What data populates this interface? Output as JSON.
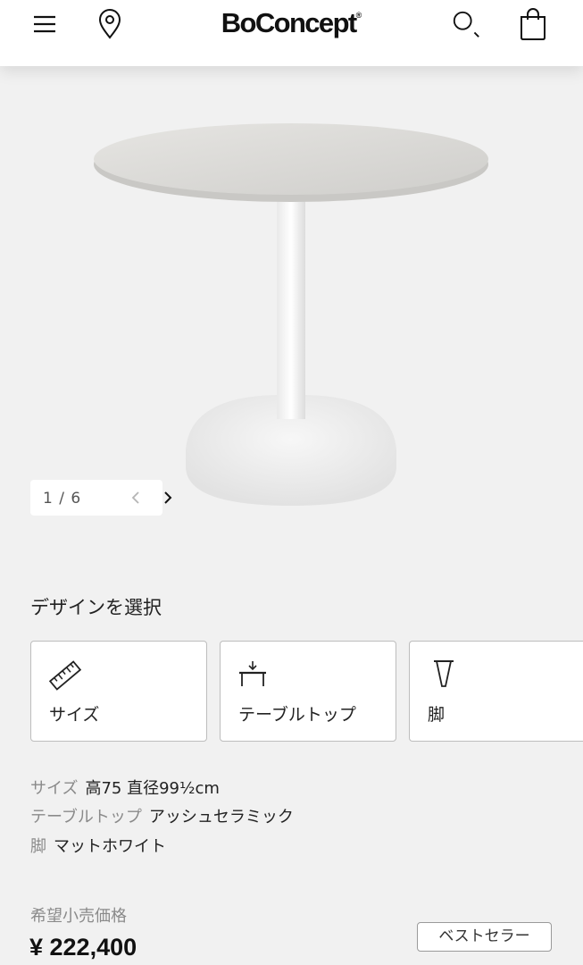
{
  "header": {
    "logo_text": "BoConcept",
    "logo_mark": "®",
    "icons": [
      "menu-icon",
      "location-pin-icon",
      "search-icon",
      "shopping-bag-icon"
    ]
  },
  "gallery": {
    "counter": "1 / 6",
    "current": 1,
    "total": 6
  },
  "design": {
    "title": "デザインを選択",
    "options": [
      {
        "label": "サイズ",
        "icon": "ruler-icon"
      },
      {
        "label": "テーブルトップ",
        "icon": "tabletop-icon"
      },
      {
        "label": "脚",
        "icon": "leg-icon"
      }
    ]
  },
  "specs": [
    {
      "key": "サイズ",
      "value": "高75 直径99½cm"
    },
    {
      "key": "テーブルトップ",
      "value": "アッシュセラミック"
    },
    {
      "key": "脚",
      "value": "マットホワイト"
    }
  ],
  "price": {
    "label": "希望小売価格",
    "value": "¥ 222,400"
  },
  "badge": "ベストセラー",
  "colors": {
    "background": "#f1f1f1",
    "header": "#ffffff",
    "table_top": "#dcdbd8",
    "table_base": "#f4f4f4"
  }
}
